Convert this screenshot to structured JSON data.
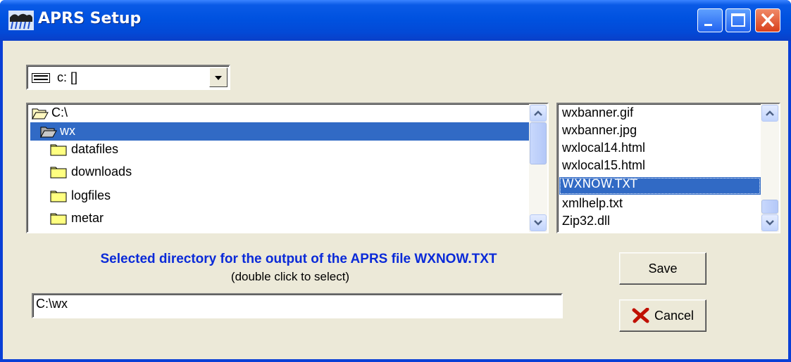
{
  "window": {
    "title": "APRS Setup",
    "buttons": [
      "minimize",
      "maximize",
      "close"
    ]
  },
  "drive": {
    "value": "c: []",
    "icon": "drive-icon"
  },
  "directories": [
    {
      "label": "C:\\",
      "icon": "open-folder-icon",
      "selected": false
    },
    {
      "label": "wx",
      "icon": "open-folder-icon",
      "selected": true
    },
    {
      "label": "datafiles",
      "icon": "folder-icon",
      "selected": false
    },
    {
      "label": "downloads",
      "icon": "folder-icon",
      "selected": false
    },
    {
      "label": "logfiles",
      "icon": "folder-icon",
      "selected": false
    },
    {
      "label": "metar",
      "icon": "folder-icon",
      "selected": false
    }
  ],
  "files": [
    {
      "label": "wxbanner.gif",
      "selected": false
    },
    {
      "label": "wxbanner.jpg",
      "selected": false
    },
    {
      "label": "wxlocal14.html",
      "selected": false
    },
    {
      "label": "wxlocal15.html",
      "selected": false
    },
    {
      "label": "WXNOW.TXT",
      "selected": true
    },
    {
      "label": "xmlhelp.txt",
      "selected": false
    },
    {
      "label": "Zip32.dll",
      "selected": false
    }
  ],
  "hint": {
    "title": "Selected directory for the output of the APRS file WXNOW.TXT",
    "subtitle": "(double click to select)"
  },
  "path": {
    "value": "C:\\wx"
  },
  "actions": {
    "save_label": "Save",
    "cancel_label": "Cancel"
  },
  "colors": {
    "selection": "#316ac5",
    "hint_text": "#0a2ad8",
    "cancel_x": "#c01000"
  }
}
